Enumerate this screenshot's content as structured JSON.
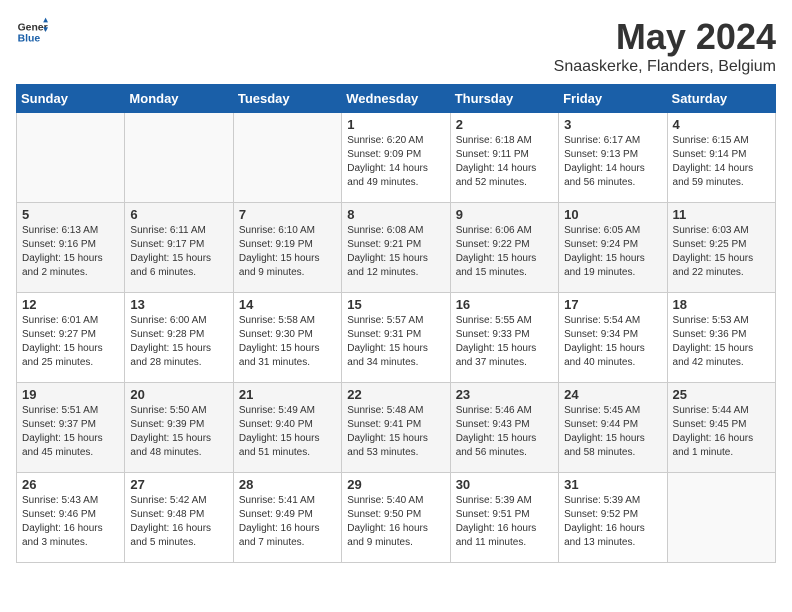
{
  "header": {
    "logo_general": "General",
    "logo_blue": "Blue",
    "month_title": "May 2024",
    "subtitle": "Snaaskerke, Flanders, Belgium"
  },
  "days_of_week": [
    "Sunday",
    "Monday",
    "Tuesday",
    "Wednesday",
    "Thursday",
    "Friday",
    "Saturday"
  ],
  "weeks": [
    [
      {
        "day": "",
        "info": ""
      },
      {
        "day": "",
        "info": ""
      },
      {
        "day": "",
        "info": ""
      },
      {
        "day": "1",
        "info": "Sunrise: 6:20 AM\nSunset: 9:09 PM\nDaylight: 14 hours\nand 49 minutes."
      },
      {
        "day": "2",
        "info": "Sunrise: 6:18 AM\nSunset: 9:11 PM\nDaylight: 14 hours\nand 52 minutes."
      },
      {
        "day": "3",
        "info": "Sunrise: 6:17 AM\nSunset: 9:13 PM\nDaylight: 14 hours\nand 56 minutes."
      },
      {
        "day": "4",
        "info": "Sunrise: 6:15 AM\nSunset: 9:14 PM\nDaylight: 14 hours\nand 59 minutes."
      }
    ],
    [
      {
        "day": "5",
        "info": "Sunrise: 6:13 AM\nSunset: 9:16 PM\nDaylight: 15 hours\nand 2 minutes."
      },
      {
        "day": "6",
        "info": "Sunrise: 6:11 AM\nSunset: 9:17 PM\nDaylight: 15 hours\nand 6 minutes."
      },
      {
        "day": "7",
        "info": "Sunrise: 6:10 AM\nSunset: 9:19 PM\nDaylight: 15 hours\nand 9 minutes."
      },
      {
        "day": "8",
        "info": "Sunrise: 6:08 AM\nSunset: 9:21 PM\nDaylight: 15 hours\nand 12 minutes."
      },
      {
        "day": "9",
        "info": "Sunrise: 6:06 AM\nSunset: 9:22 PM\nDaylight: 15 hours\nand 15 minutes."
      },
      {
        "day": "10",
        "info": "Sunrise: 6:05 AM\nSunset: 9:24 PM\nDaylight: 15 hours\nand 19 minutes."
      },
      {
        "day": "11",
        "info": "Sunrise: 6:03 AM\nSunset: 9:25 PM\nDaylight: 15 hours\nand 22 minutes."
      }
    ],
    [
      {
        "day": "12",
        "info": "Sunrise: 6:01 AM\nSunset: 9:27 PM\nDaylight: 15 hours\nand 25 minutes."
      },
      {
        "day": "13",
        "info": "Sunrise: 6:00 AM\nSunset: 9:28 PM\nDaylight: 15 hours\nand 28 minutes."
      },
      {
        "day": "14",
        "info": "Sunrise: 5:58 AM\nSunset: 9:30 PM\nDaylight: 15 hours\nand 31 minutes."
      },
      {
        "day": "15",
        "info": "Sunrise: 5:57 AM\nSunset: 9:31 PM\nDaylight: 15 hours\nand 34 minutes."
      },
      {
        "day": "16",
        "info": "Sunrise: 5:55 AM\nSunset: 9:33 PM\nDaylight: 15 hours\nand 37 minutes."
      },
      {
        "day": "17",
        "info": "Sunrise: 5:54 AM\nSunset: 9:34 PM\nDaylight: 15 hours\nand 40 minutes."
      },
      {
        "day": "18",
        "info": "Sunrise: 5:53 AM\nSunset: 9:36 PM\nDaylight: 15 hours\nand 42 minutes."
      }
    ],
    [
      {
        "day": "19",
        "info": "Sunrise: 5:51 AM\nSunset: 9:37 PM\nDaylight: 15 hours\nand 45 minutes."
      },
      {
        "day": "20",
        "info": "Sunrise: 5:50 AM\nSunset: 9:39 PM\nDaylight: 15 hours\nand 48 minutes."
      },
      {
        "day": "21",
        "info": "Sunrise: 5:49 AM\nSunset: 9:40 PM\nDaylight: 15 hours\nand 51 minutes."
      },
      {
        "day": "22",
        "info": "Sunrise: 5:48 AM\nSunset: 9:41 PM\nDaylight: 15 hours\nand 53 minutes."
      },
      {
        "day": "23",
        "info": "Sunrise: 5:46 AM\nSunset: 9:43 PM\nDaylight: 15 hours\nand 56 minutes."
      },
      {
        "day": "24",
        "info": "Sunrise: 5:45 AM\nSunset: 9:44 PM\nDaylight: 15 hours\nand 58 minutes."
      },
      {
        "day": "25",
        "info": "Sunrise: 5:44 AM\nSunset: 9:45 PM\nDaylight: 16 hours\nand 1 minute."
      }
    ],
    [
      {
        "day": "26",
        "info": "Sunrise: 5:43 AM\nSunset: 9:46 PM\nDaylight: 16 hours\nand 3 minutes."
      },
      {
        "day": "27",
        "info": "Sunrise: 5:42 AM\nSunset: 9:48 PM\nDaylight: 16 hours\nand 5 minutes."
      },
      {
        "day": "28",
        "info": "Sunrise: 5:41 AM\nSunset: 9:49 PM\nDaylight: 16 hours\nand 7 minutes."
      },
      {
        "day": "29",
        "info": "Sunrise: 5:40 AM\nSunset: 9:50 PM\nDaylight: 16 hours\nand 9 minutes."
      },
      {
        "day": "30",
        "info": "Sunrise: 5:39 AM\nSunset: 9:51 PM\nDaylight: 16 hours\nand 11 minutes."
      },
      {
        "day": "31",
        "info": "Sunrise: 5:39 AM\nSunset: 9:52 PM\nDaylight: 16 hours\nand 13 minutes."
      },
      {
        "day": "",
        "info": ""
      }
    ]
  ]
}
